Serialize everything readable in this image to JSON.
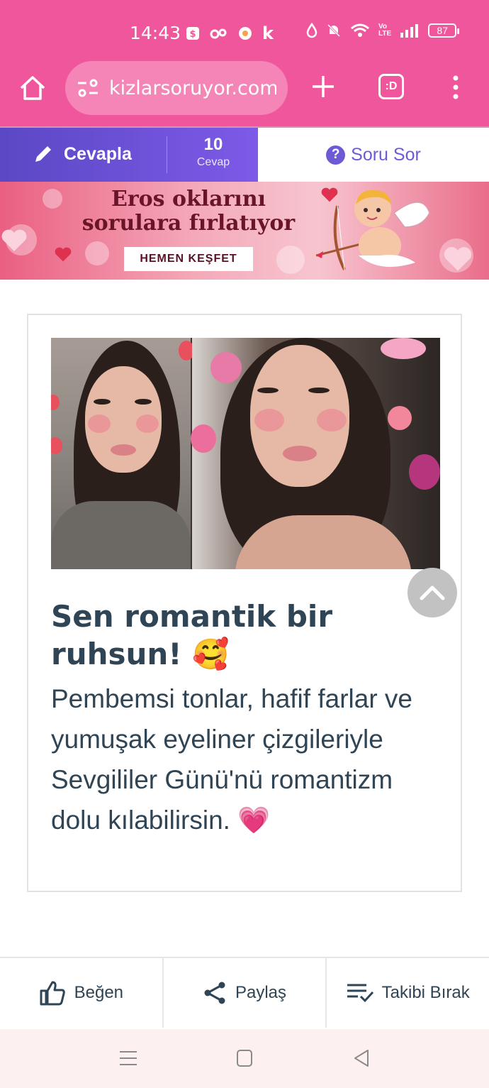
{
  "status_bar": {
    "time": "14:43",
    "battery": "87",
    "left_icons": [
      "payment-app-icon",
      "link-icon",
      "chat-icon",
      "k-app-icon"
    ],
    "right_icons": [
      "drop-icon",
      "bell-muted-icon",
      "wifi-icon",
      "volte-icon",
      "signal-icon",
      "battery-icon"
    ]
  },
  "browser": {
    "url": "kizlarsoruyor.com/",
    "tabs_count_label": ":D"
  },
  "action_tabs": {
    "answer_label": "Cevapla",
    "answer_count": "10",
    "answer_count_label": "Cevap",
    "ask_label": "Soru Sor"
  },
  "banner": {
    "title_line1": "Eros oklarını",
    "title_line2": "sorulara fırlatıyor",
    "cta": "HEMEN KEŞFET"
  },
  "card": {
    "title": "Sen romantik bir ruhsun! 🥰",
    "description": "Pembemsi tonlar, hafif farlar ve yumuşak eyeliner çizgileriyle Sevgililer Günü'nü romantizm dolu kılabilirsin. 💗"
  },
  "bottom_actions": {
    "like": "Beğen",
    "share": "Paylaş",
    "unfollow": "Takibi Bırak"
  },
  "colors": {
    "brand_pink": "#f0569b",
    "purple": "#6d5bd6",
    "text_dark": "#2f4454"
  }
}
